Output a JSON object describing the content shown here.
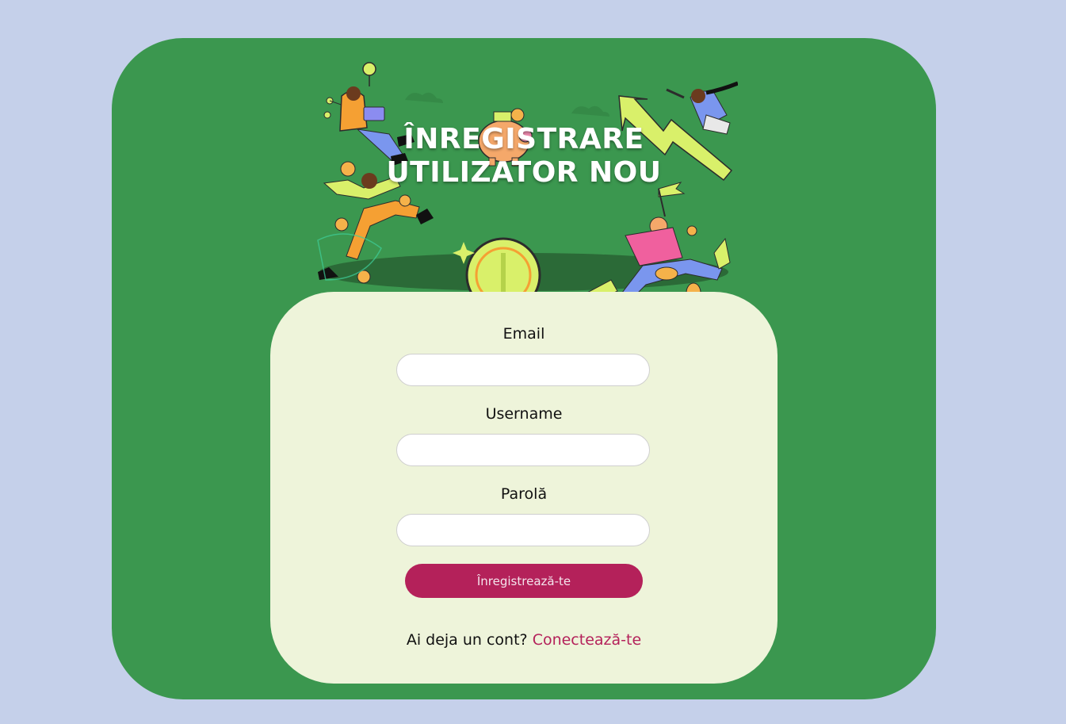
{
  "hero": {
    "title_line1": "ÎNREGISTRARE",
    "title_line2": "UTILIZATOR NOU"
  },
  "form": {
    "email_label": "Email",
    "email_value": "",
    "username_label": "Username",
    "username_value": "",
    "password_label": "Parolă",
    "password_value": "",
    "submit_label": "Înregistrează-te"
  },
  "footer": {
    "prompt": "Ai deja un cont?",
    "login_link": "Conectează-te"
  },
  "colors": {
    "page_background": "#c5d0ea",
    "card_green": "#3b974f",
    "form_background": "#eef4da",
    "accent": "#b4215a"
  }
}
